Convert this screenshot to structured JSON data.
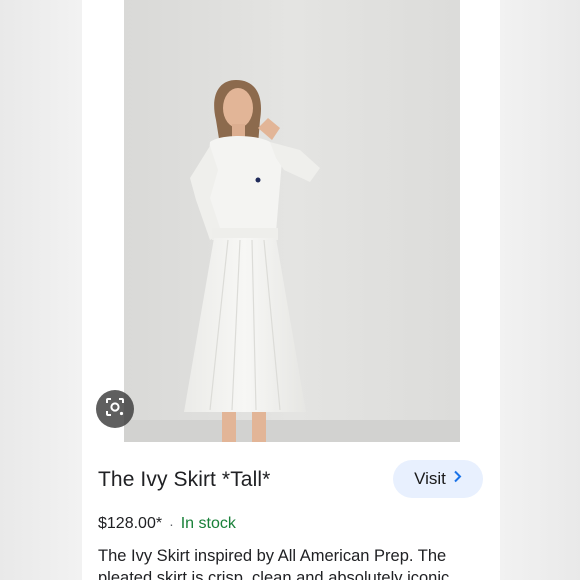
{
  "product": {
    "title": "The Ivy Skirt *Tall*",
    "price": "$128.00*",
    "separator": "·",
    "availability": "In stock",
    "description_line1": "The Ivy Skirt inspired by All American Prep. The",
    "description_line2": "pleated skirt is crisp, clean and absolutely iconic."
  },
  "actions": {
    "visit_label": "Visit"
  },
  "icons": {
    "lens": "lens-search-icon",
    "visit_chevron": "chevron-right-icon"
  },
  "colors": {
    "visit_bg": "#e8f0fe",
    "in_stock": "#188038",
    "chevron": "#1a73e8"
  }
}
